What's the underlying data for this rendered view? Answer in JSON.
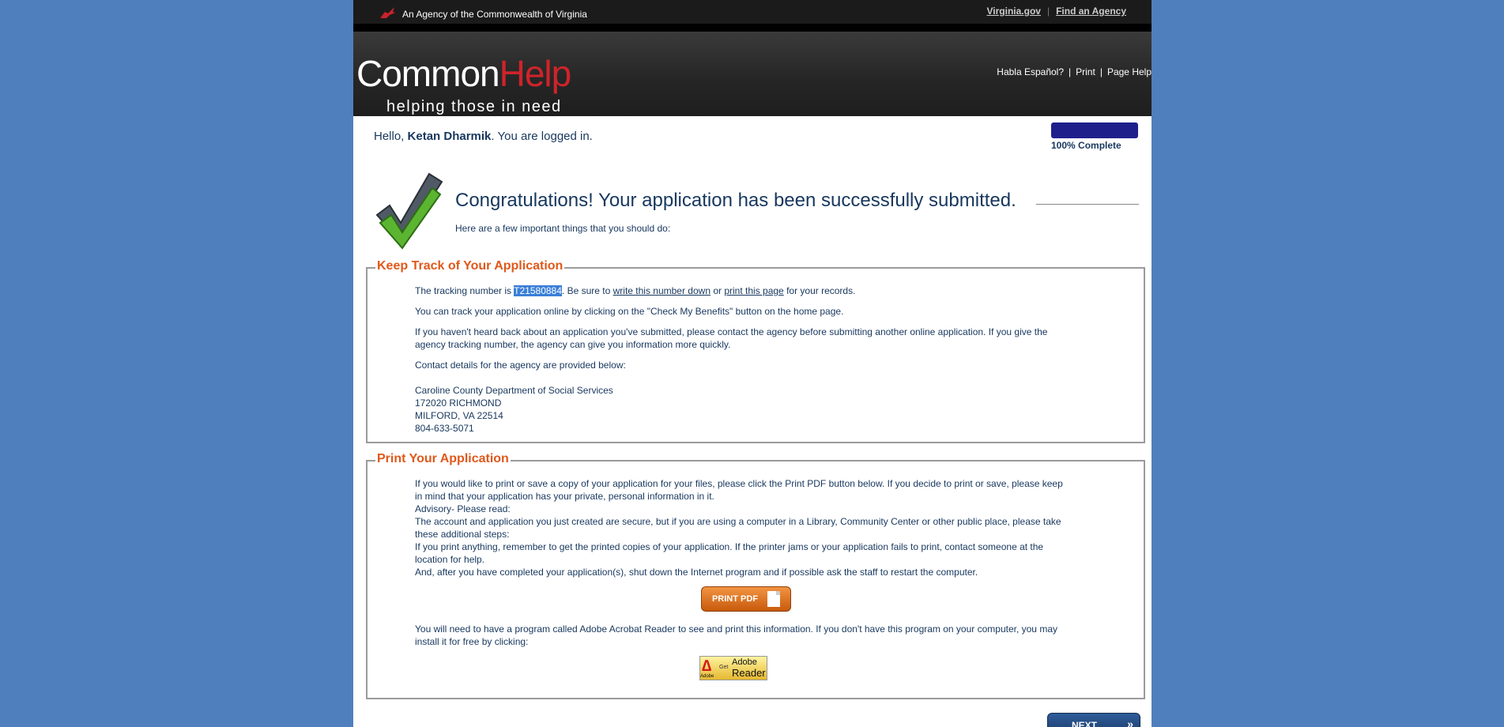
{
  "topbar": {
    "agency_text": "An Agency of the Commonwealth of Virginia",
    "link_virginia": "Virginia.gov",
    "separator": "|",
    "link_find_agency": "Find an Agency"
  },
  "header": {
    "logo_common": "Common",
    "logo_help": "Help",
    "logo_tagline": "helping those in need",
    "link_espanol": "Habla Español?",
    "sep": "|",
    "link_print": "Print",
    "link_page_help": "Page Help"
  },
  "greeting": {
    "hello": "Hello, ",
    "name": "Ketan Dharmik",
    "suffix": ". You are logged in."
  },
  "progress": {
    "label": "100% Complete",
    "fraction": 1.0
  },
  "congrats": {
    "title": "Congratulations! Your application has been successfully submitted.",
    "subtitle": "Here are a few important things that you should do:"
  },
  "track": {
    "legend": "Keep Track of Your Application",
    "tracking_prefix": "The tracking number is ",
    "tracking_number": "T21580884",
    "tracking_mid": ". Be sure to ",
    "write_link": "write this number down",
    "or": " or ",
    "print_link": "print this page",
    "tracking_suffix": " for your records.",
    "p2": "You can track your application online by clicking on the \"Check My Benefits\" button on the home page.",
    "p3": "If you haven't heard back about an application you've submitted, please contact the agency before submitting another online application. If you give the agency tracking number, the agency can give you information more quickly.",
    "p4": "Contact details for the agency are provided below:",
    "agency_name": "Caroline County Department of Social Services",
    "agency_street": "172020 RICHMOND",
    "agency_city": "MILFORD, VA 22514",
    "agency_phone": "804-633-5071"
  },
  "print": {
    "legend": "Print Your Application",
    "l1": "If you would like to print or save a copy of your application for your files, please click the Print PDF button below. If you decide to print or save, please keep in mind that your application has your private, personal information in it.",
    "l2": "Advisory- Please read:",
    "l3": "The account and application you just created are secure, but if you are using a computer in a Library, Community Center or other public place, please take these additional steps:",
    "l4": "If you print anything, remember to get the printed copies of your application. If the printer jams or your application fails to print, contact someone at the location for help.",
    "l5": "And, after you have completed your application(s), shut down the Internet program and if possible ask the staff to restart the computer.",
    "button": "PRINT PDF",
    "adobe_note": "You will need to have a program called Adobe Acrobat Reader to see and print this information. If you don't have this program on your computer, you may install it for free by clicking:",
    "adobe_small": "Adobe",
    "adobe_get": "Get",
    "adobe_t1": "Adobe",
    "adobe_t2": "Reader"
  },
  "next_button": "NEXT",
  "colors": {
    "background": "#4f7fbd",
    "accent_orange": "#e0581a",
    "brand_red": "#d0232a",
    "text_navy": "#17375e",
    "progress_blue": "#1f1f8c"
  },
  "icons": [
    "virginia-seal-icon",
    "checkmark-icon",
    "document-icon",
    "double-chevron-right-icon"
  ]
}
